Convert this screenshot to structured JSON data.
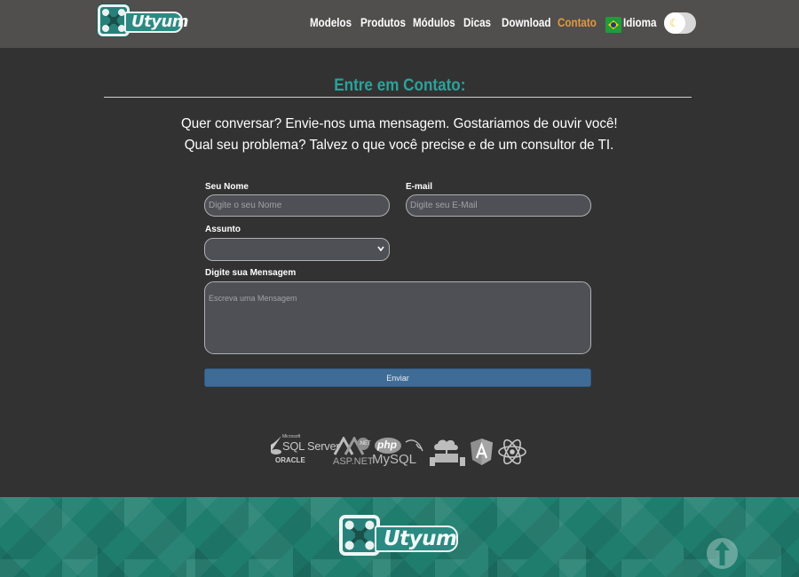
{
  "header": {
    "logo_icon": "utyum-logo-icon",
    "logo_text": "Utyum",
    "nav": [
      {
        "label": "Modelos",
        "active": false
      },
      {
        "label": "Produtos",
        "active": false
      },
      {
        "label": "Módulos",
        "active": false
      },
      {
        "label": "Dicas",
        "active": false
      },
      {
        "label": "Download",
        "active": false
      },
      {
        "label": "Contato",
        "active": true
      }
    ],
    "language": {
      "label": "Idioma",
      "flag_icon": "brazil-flag-icon"
    },
    "theme_toggle_icon": "moon-icon"
  },
  "contact": {
    "title": "Entre em Contato:",
    "intro_line1": "Quer conversar? Envie-nos uma mensagem. Gostariamos de ouvir você!",
    "intro_line2": "Qual seu problema? Talvez o que você precise e de um consultor de TI.",
    "form": {
      "name": {
        "label": "Seu Nome",
        "placeholder": "Digite o seu Nome",
        "value": ""
      },
      "email": {
        "label": "E-mail",
        "placeholder": "Digite seu E-Mail",
        "value": ""
      },
      "subject": {
        "label": "Assunto",
        "selected": ""
      },
      "message": {
        "label": "Digite sua Mensagem",
        "placeholder": "Escreva uma Mensagem",
        "value": ""
      },
      "submit_label": "Enviar"
    }
  },
  "tech_logos": {
    "sqlserver_small": "Microsoft",
    "sqlserver": "SQL Server",
    "oracle": "ORACLE",
    "dotnet_small": ".NET",
    "aspnet": "ASP.NET",
    "php": "php",
    "mysql": "MySQL",
    "icons": [
      "sql-server-icon",
      "oracle-icon",
      "dotnet-icon",
      "php-icon",
      "mysql-icon",
      "cloud-network-icon",
      "angular-icon",
      "react-icon"
    ]
  },
  "footer": {
    "logo_text": "Utyum",
    "back_to_top_icon": "arrow-up-icon"
  },
  "colors": {
    "header_bg": "#514e4e",
    "page_bg": "#323232",
    "title_teal": "#2aa39a",
    "active_nav": "#e09a3a",
    "button_blue": "#3f6c97",
    "footer_teal": "#1f7d6e"
  }
}
